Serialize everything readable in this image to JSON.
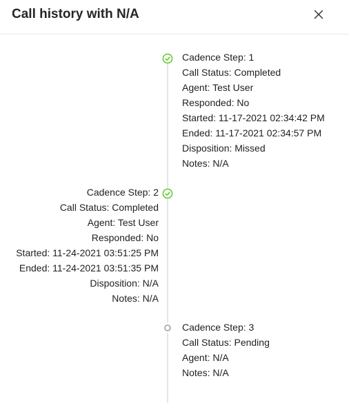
{
  "dialog": {
    "title": "Call history with N/A",
    "close_label": "X"
  },
  "timeline": [
    {
      "status_icon": "check-circle-icon",
      "status_color": "#52c41a",
      "lines": [
        "Cadence Step: 1",
        "Call Status: Completed",
        "Agent: Test User",
        "Responded: No",
        "Started: 11-17-2021 02:34:42 PM",
        "Ended: 11-17-2021 02:34:57 PM",
        "Disposition: Missed",
        "Notes: N/A"
      ]
    },
    {
      "status_icon": "check-circle-icon",
      "status_color": "#52c41a",
      "lines": [
        "Cadence Step: 2",
        "Call Status: Completed",
        "Agent: Test User",
        "Responded: No",
        "Started: 11-24-2021 03:51:25 PM",
        "Ended: 11-24-2021 03:51:35 PM",
        "Disposition: N/A",
        "Notes: N/A"
      ]
    },
    {
      "status_icon": "hollow-circle-icon",
      "status_color": "#a0a0a0",
      "lines": [
        "Cadence Step: 3",
        "Call Status: Pending",
        "Agent: N/A",
        "Notes: N/A"
      ]
    }
  ]
}
